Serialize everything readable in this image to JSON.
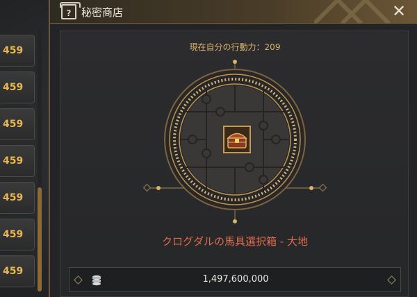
{
  "left_list": {
    "rows": [
      "459",
      "459",
      "459",
      "459",
      "459",
      "459",
      "459"
    ]
  },
  "dialog": {
    "title": "秘密商店",
    "close_label": "✕",
    "action_points_label": "現在自分の行動力：209",
    "item": {
      "name": "クログダルの馬具選択箱 - 大地",
      "icon": "treasure-chest-icon",
      "name_color": "#e36a4c"
    },
    "price": {
      "currency_icon": "silver-coins-icon",
      "value": "1,497,600,000"
    }
  },
  "colors": {
    "accent_gold": "#d9b46a",
    "list_value": "#e8b64c"
  }
}
